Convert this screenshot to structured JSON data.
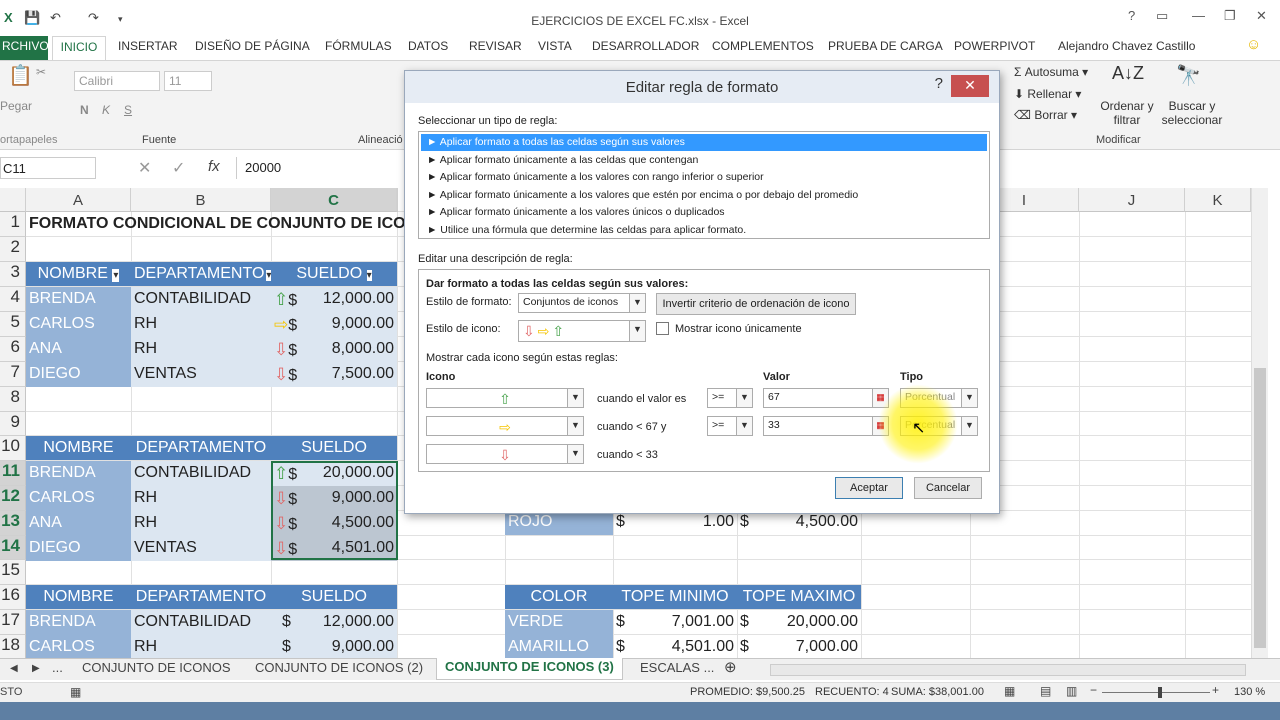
{
  "window": {
    "title": "EJERCICIOS DE EXCEL FC.xlsx - Excel"
  },
  "ribbon_tabs": [
    "RCHIVO",
    "INICIO",
    "INSERTAR",
    "DISEÑO DE PÁGINA",
    "FÓRMULAS",
    "DATOS",
    "REVISAR",
    "VISTA",
    "DESARROLLADOR",
    "COMPLEMENTOS",
    "PRUEBA DE CARGA",
    "POWERPIVOT"
  ],
  "user": "Alejandro Chavez Castillo",
  "ribbon": {
    "paste": "Pegar",
    "clipboard": "ortapapeles",
    "font_name": "Calibri",
    "font_size": "11",
    "bold": "N",
    "italic": "K",
    "underline": "S",
    "font_group": "Fuente",
    "align_group": "Alineació",
    "autosum": "Autosuma",
    "fill": "Rellenar",
    "clear": "Borrar",
    "sort": "Ordenar y filtrar",
    "find": "Buscar y seleccionar",
    "modify_group": "Modificar"
  },
  "formula_bar": {
    "name_box": "C11",
    "fx": "fx",
    "value": "20000"
  },
  "columns": [
    "A",
    "B",
    "C",
    "I",
    "J",
    "K"
  ],
  "rows": [
    "1",
    "2",
    "3",
    "4",
    "5",
    "6",
    "7",
    "8",
    "9",
    "10",
    "11",
    "12",
    "13",
    "14",
    "15",
    "16",
    "17",
    "18"
  ],
  "sheet": {
    "title": "FORMATO CONDICIONAL DE CONJUNTO DE ICO",
    "headers": {
      "nombre": "NOMBRE",
      "departamento": "DEPARTAMENTO",
      "sueldo": "SUELDO"
    },
    "table1": [
      {
        "nombre": "BRENDA",
        "dep": "CONTABILIDAD",
        "icon": "up",
        "sueldo": "12,000.00"
      },
      {
        "nombre": "CARLOS",
        "dep": "RH",
        "icon": "right",
        "sueldo": "9,000.00"
      },
      {
        "nombre": "ANA",
        "dep": "RH",
        "icon": "down",
        "sueldo": "8,000.00"
      },
      {
        "nombre": "DIEGO",
        "dep": "VENTAS",
        "icon": "down",
        "sueldo": "7,500.00"
      }
    ],
    "table2": [
      {
        "nombre": "BRENDA",
        "dep": "CONTABILIDAD",
        "icon": "up",
        "sueldo": "20,000.00"
      },
      {
        "nombre": "CARLOS",
        "dep": "RH",
        "icon": "down",
        "sueldo": "9,000.00"
      },
      {
        "nombre": "ANA",
        "dep": "RH",
        "icon": "down",
        "sueldo": "4,500.00"
      },
      {
        "nombre": "DIEGO",
        "dep": "VENTAS",
        "icon": "down",
        "sueldo": "4,501.00"
      }
    ],
    "table3": [
      {
        "nombre": "BRENDA",
        "dep": "CONTABILIDAD",
        "sueldo": "12,000.00"
      },
      {
        "nombre": "CARLOS",
        "dep": "RH",
        "sueldo": "9,000.00"
      }
    ],
    "currency": "$",
    "rojo_row": {
      "color": "ROJO",
      "min": "1.00",
      "max": "4,500.00"
    },
    "color_table": {
      "headers": {
        "color": "COLOR",
        "min": "TOPE MINIMO",
        "max": "TOPE MAXIMO"
      },
      "rows": [
        {
          "color": "VERDE",
          "min": "7,001.00",
          "max": "20,000.00"
        },
        {
          "color": "AMARILLO",
          "min": "4,501.00",
          "max": "7,000.00"
        }
      ]
    }
  },
  "sheet_tabs": [
    "...",
    "CONJUNTO DE ICONOS",
    "CONJUNTO DE ICONOS (2)",
    "CONJUNTO DE ICONOS (3)",
    "ESCALAS ..."
  ],
  "status": {
    "mode": "STO",
    "promedio": "PROMEDIO: $9,500.25",
    "recuento": "RECUENTO: 4",
    "suma": "SUMA: $38,001.00",
    "zoom": "130 %"
  },
  "dialog": {
    "title": "Editar regla de formato",
    "help": "?",
    "close": "✕",
    "select_type_label": "Seleccionar un tipo de regla:",
    "rule_types": [
      "► Aplicar formato a todas las celdas según sus valores",
      "► Aplicar formato únicamente a las celdas que contengan",
      "► Aplicar formato únicamente a los valores con rango inferior o superior",
      "► Aplicar formato únicamente a los valores que estén por encima o por debajo del promedio",
      "► Aplicar formato únicamente a los valores únicos o duplicados",
      "► Utilice una fórmula que determine las celdas para aplicar formato."
    ],
    "edit_desc_label": "Editar una descripción de regla:",
    "desc_heading": "Dar formato a todas las celdas según sus valores:",
    "format_style_label": "Estilo de formato:",
    "format_style_value": "Conjuntos de iconos",
    "reverse_button": "Invertir criterio de ordenación de icono",
    "icon_style_label": "Estilo de icono:",
    "show_icon_only": "Mostrar icono únicamente",
    "rules_label": "Mostrar cada icono según estas reglas:",
    "col_icon": "Icono",
    "col_value": "Valor",
    "col_type": "Tipo",
    "rule1": {
      "when": "cuando el valor es",
      "op": ">=",
      "value": "67",
      "type": "Porcentual"
    },
    "rule2": {
      "when": "cuando < 67 y",
      "op": ">=",
      "value": "33",
      "type": "Porcentual"
    },
    "rule3": {
      "when": "cuando < 33"
    },
    "accept": "Aceptar",
    "cancel": "Cancelar"
  }
}
